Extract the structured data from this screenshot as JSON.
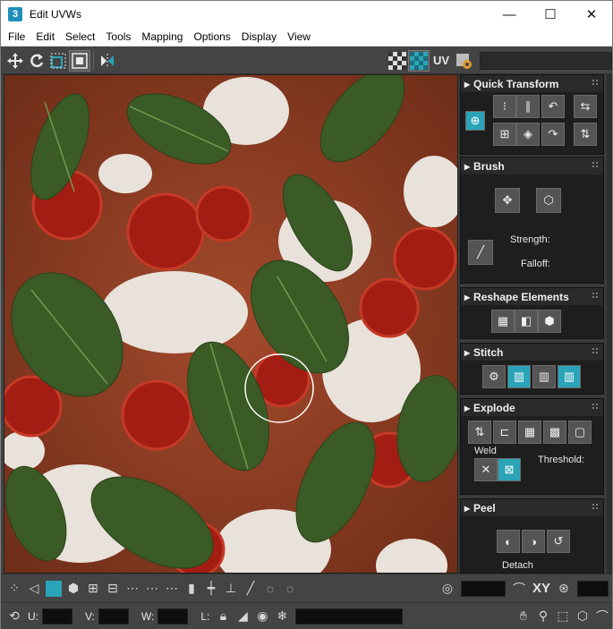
{
  "window": {
    "app_icon": "3",
    "title": "Edit UVWs",
    "minimize_glyph": "—",
    "maximize_glyph": "☐",
    "close_glyph": "✕"
  },
  "menubar": {
    "items": [
      {
        "label": "File"
      },
      {
        "label": "Edit"
      },
      {
        "label": "Select"
      },
      {
        "label": "Tools"
      },
      {
        "label": "Mapping"
      },
      {
        "label": "Options"
      },
      {
        "label": "Display"
      },
      {
        "label": "View"
      }
    ]
  },
  "toolbar": {
    "icons": [
      "move-icon",
      "rotate-icon",
      "scale-icon",
      "freeform-icon",
      "mirror-icon"
    ],
    "uv_label": "UV"
  },
  "panel": {
    "quick_transform": {
      "title": "Quick Transform"
    },
    "brush": {
      "title": "Brush",
      "strength_label": "Strength:",
      "falloff_label": "Falloff:"
    },
    "reshape": {
      "title": "Reshape Elements"
    },
    "stitch": {
      "title": "Stitch"
    },
    "explode": {
      "title": "Explode",
      "weld_label": "Weld",
      "threshold_label": "Threshold:"
    },
    "peel": {
      "title": "Peel",
      "detach_label": "Detach"
    }
  },
  "bottom": {
    "xy_label": "XY",
    "u_label": "U:",
    "v_label": "V:",
    "w_label": "W:",
    "l_label": "L:"
  },
  "colors": {
    "accent_teal": "#2ba4b8",
    "panel_bg": "#1e1e1e",
    "ui_bg": "#444444"
  }
}
